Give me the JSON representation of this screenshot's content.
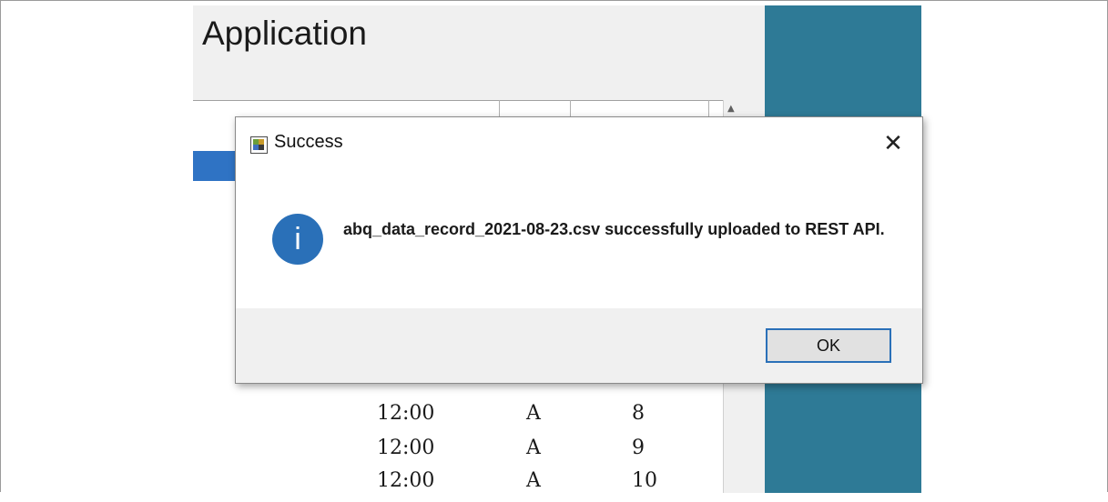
{
  "app": {
    "title": "Application"
  },
  "table": {
    "rows": [
      {
        "time": "12:00",
        "group": "A",
        "num": "8"
      },
      {
        "time": "12:00",
        "group": "A",
        "num": "9"
      },
      {
        "time": "12:00",
        "group": "A",
        "num": "10"
      }
    ]
  },
  "dialog": {
    "title": "Success",
    "close_symbol": "✕",
    "message": "abq_data_record_2021-08-23.csv successfully uploaded to REST API.",
    "ok_label": "OK",
    "info_symbol": "i"
  },
  "colors": {
    "accent": "#2a70b8",
    "teal": "#2e7a96",
    "selection": "#2f73c4"
  },
  "icons": {
    "app_icon": "app-icon",
    "info": "info-icon",
    "close": "close-icon"
  }
}
